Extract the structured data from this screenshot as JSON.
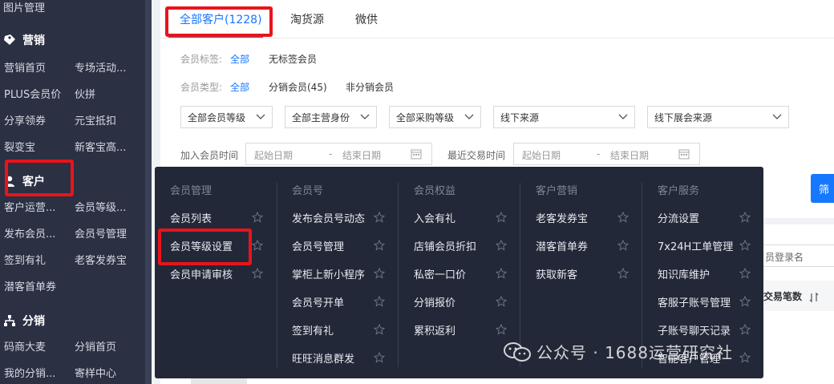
{
  "sidebar": {
    "top_item": "图片管理",
    "marketing": {
      "heading": "营销",
      "icon": "tag-icon",
      "items": [
        [
          "营销首页",
          "专场活动..."
        ],
        [
          "PLUS会员价",
          "伙拼"
        ],
        [
          "分享领券",
          "元宝抵扣"
        ],
        [
          "裂变宝",
          "新客宝高..."
        ]
      ]
    },
    "customer": {
      "heading": "客户",
      "icon": "user-icon",
      "items": [
        [
          "客户运营...",
          "会员等级..."
        ],
        [
          "发布会员...",
          "会员号管理"
        ],
        [
          "签到有礼",
          "老客发券宝"
        ],
        [
          "潜客首单券",
          ""
        ]
      ]
    },
    "distribution": {
      "heading": "分销",
      "icon": "network-icon",
      "items": [
        [
          "码商大麦",
          "分销首页"
        ],
        [
          "我的分销...",
          "寄样中心"
        ]
      ]
    }
  },
  "tabs": [
    {
      "label": "全部客户(1228)",
      "active": true
    },
    {
      "label": "淘货源",
      "active": false
    },
    {
      "label": "微供",
      "active": false
    }
  ],
  "filters": {
    "member_tag": {
      "label": "会员标签:",
      "options": [
        "全部",
        "无标签会员"
      ]
    },
    "member_type": {
      "label": "会员类型:",
      "options": [
        "全部",
        "分销会员(45)",
        "非分销会员"
      ]
    },
    "selects": [
      "全部会员等级",
      "全部主营身份",
      "全部采购等级",
      "线下来源",
      "线下展会来源"
    ],
    "join_time": {
      "label": "加入会员时间",
      "start": "起始日期",
      "sep": "-",
      "end": "结束日期"
    },
    "last_trade": {
      "label": "最近交易时间",
      "start": "起始日期",
      "sep": "-",
      "end": "结束日期"
    }
  },
  "right_partial": {
    "button": "筛",
    "login_placeholder": "员登录名",
    "column_header": "交易笔数",
    "sort_icon": "sort-icon"
  },
  "mega_menu": {
    "columns": [
      {
        "title": "会员管理",
        "items": [
          "会员列表",
          "会员等级设置",
          "会员申请审核"
        ]
      },
      {
        "title": "会员号",
        "items": [
          "发布会员号动态",
          "会员号管理",
          "掌柜上新小程序",
          "会员号开单",
          "签到有礼",
          "旺旺消息群发"
        ]
      },
      {
        "title": "会员权益",
        "items": [
          "入会有礼",
          "店铺会员折扣",
          "私密一口价",
          "分销报价",
          "累积返利"
        ]
      },
      {
        "title": "客户营销",
        "items": [
          "老客发券宝",
          "潜客首单券",
          "获取新客"
        ]
      },
      {
        "title": "客户服务",
        "items": [
          "分流设置",
          "7x24H工单管理",
          "知识库维护",
          "客服子账号管理",
          "子账号聊天记录",
          "智能客户管理"
        ]
      }
    ],
    "star_icon": "star-icon"
  },
  "watermark": {
    "text": "公众号 · 1688运营研究社",
    "icon": "wechat-icon"
  },
  "colors": {
    "accent": "#1677ff",
    "highlight": "#e8141b",
    "sidebar_bg": "#2b3043",
    "menu_bg": "#232838"
  }
}
